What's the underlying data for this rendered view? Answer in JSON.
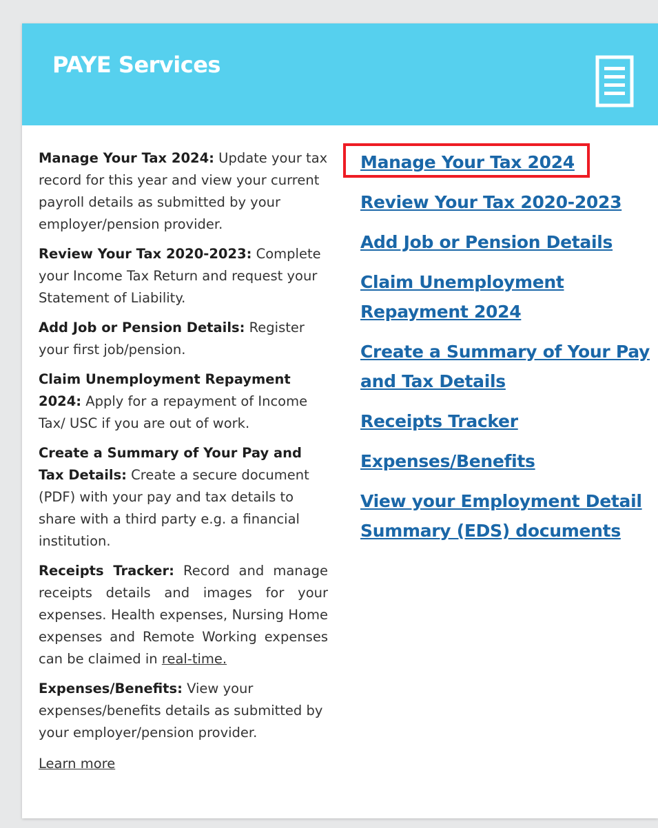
{
  "card": {
    "title": "PAYE Services",
    "icon": "document-icon"
  },
  "descriptions": [
    {
      "term": "Manage Your Tax 2024:",
      "text": " Update your tax record for this year and view your current payroll details as submitted by your employer/pension provider."
    },
    {
      "term": "Review Your Tax 2020-2023:",
      "text": " Complete your Income Tax Return and request your Statement of Liability."
    },
    {
      "term": "Add Job or Pension Details:",
      "text": " Register your first job/pension."
    },
    {
      "term": "Claim Unemployment Repayment 2024:",
      "text": " Apply for a repayment of Income Tax/ USC if you are out of work."
    },
    {
      "term": "Create a Summary of Your Pay and Tax Details:",
      "text": " Create a secure document (PDF) with your pay and tax details to share with a third party e.g. a financial institution."
    },
    {
      "term": "Receipts Tracker:",
      "text": " Record and manage receipts details and images for your expenses. Health expenses, Nursing Home expenses and Remote Working expenses can be claimed in ",
      "link": "real-time."
    },
    {
      "term": "Expenses/Benefits:",
      "text": " View your expenses/benefits details as submitted by your employer/pension provider."
    }
  ],
  "learn_more": "Learn more",
  "links": [
    "Manage Your Tax 2024",
    "Review Your Tax 2020-2023",
    "Add Job or Pension Details",
    "Claim Unemployment Repayment 2024",
    "Create a Summary of Your Pay and Tax Details",
    "Receipts Tracker",
    "Expenses/Benefits",
    "View your Employment Detail Summary (EDS) documents"
  ],
  "highlighted_link": "Manage Your Tax 2024",
  "colors": {
    "header_bg": "#56d0ee",
    "link": "#1a67a8",
    "highlight": "#ee1c24",
    "page_bg": "#e7e8e9"
  }
}
